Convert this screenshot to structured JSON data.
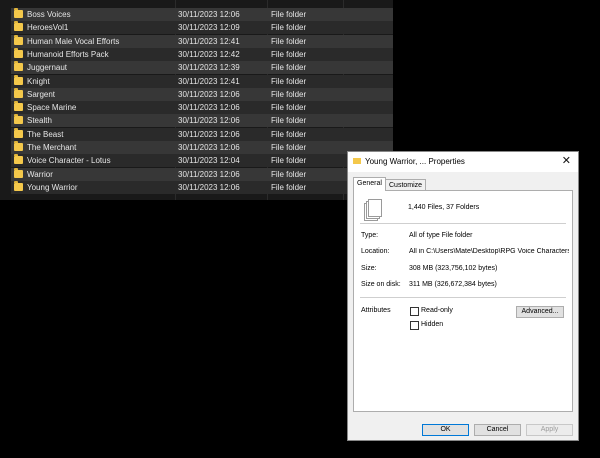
{
  "explorer": {
    "rows": [
      {
        "name": "Boss Voices",
        "date": "30/11/2023 12:06",
        "type": "File folder"
      },
      {
        "name": "HeroesVol1",
        "date": "30/11/2023 12:09",
        "type": "File folder"
      },
      {
        "name": "Human Male Vocal Efforts",
        "date": "30/11/2023 12:41",
        "type": "File folder"
      },
      {
        "name": "Humanoid Efforts Pack",
        "date": "30/11/2023 12:42",
        "type": "File folder"
      },
      {
        "name": "Juggernaut",
        "date": "30/11/2023 12:39",
        "type": "File folder"
      },
      {
        "name": "Knight",
        "date": "30/11/2023 12:41",
        "type": "File folder"
      },
      {
        "name": "Sargent",
        "date": "30/11/2023 12:06",
        "type": "File folder"
      },
      {
        "name": "Space Marine",
        "date": "30/11/2023 12:06",
        "type": "File folder"
      },
      {
        "name": "Stealth",
        "date": "30/11/2023 12:06",
        "type": "File folder"
      },
      {
        "name": "The Beast",
        "date": "30/11/2023 12:06",
        "type": "File folder"
      },
      {
        "name": "The Merchant",
        "date": "30/11/2023 12:06",
        "type": "File folder"
      },
      {
        "name": "Voice Character - Lotus",
        "date": "30/11/2023 12:04",
        "type": "File folder"
      },
      {
        "name": "Warrior",
        "date": "30/11/2023 12:06",
        "type": "File folder"
      },
      {
        "name": "Young Warrior",
        "date": "30/11/2023 12:06",
        "type": "File folder"
      }
    ]
  },
  "dialog": {
    "title": "Young Warrior, ... Properties",
    "close_glyph": "✕",
    "tabs": [
      "General",
      "Customize"
    ],
    "summary": "1,440 Files, 37 Folders",
    "fields": {
      "type_label": "Type:",
      "type_value": "All of type File folder",
      "location_label": "Location:",
      "location_value": "All in C:\\Users\\Mate\\Desktop\\RPG Voice Characters",
      "size_label": "Size:",
      "size_value": "308 MB (323,756,102 bytes)",
      "disk_label": "Size on disk:",
      "disk_value": "311 MB (326,672,384 bytes)"
    },
    "attributes": {
      "label": "Attributes",
      "readonly": "Read-only",
      "hidden": "Hidden",
      "advanced": "Advanced..."
    },
    "buttons": {
      "ok": "OK",
      "cancel": "Cancel",
      "apply": "Apply"
    },
    "colors": {
      "folder": "#f4c84b",
      "primary_border": "#0078d7"
    }
  }
}
